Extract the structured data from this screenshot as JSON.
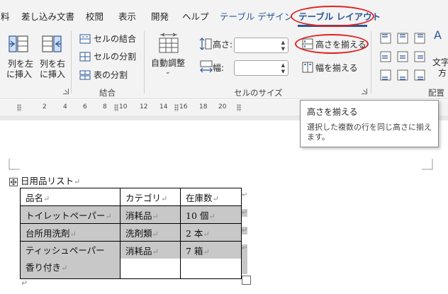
{
  "ribbon": {
    "tabs": [
      {
        "label": "料"
      },
      {
        "label": "差し込み文書"
      },
      {
        "label": "校閲"
      },
      {
        "label": "表示"
      },
      {
        "label": "開発"
      },
      {
        "label": "ヘルプ"
      },
      {
        "label": "テーブル デザイン"
      },
      {
        "label": "テーブル レイアウト"
      }
    ],
    "active_tab": "テーブル レイアウト",
    "groups": {
      "rows_cols": {
        "insert_left": {
          "line1": "列を左",
          "line2": "に挿入"
        },
        "insert_right": {
          "line1": "列を右",
          "line2": "に挿入"
        }
      },
      "merge": {
        "label": "結合",
        "merge_cells": "セルの結合",
        "split_cells": "セルの分割",
        "split_table": "表の分割"
      },
      "cell_size": {
        "label": "セルのサイズ",
        "autofit": "自動調整",
        "height_label": "高さ:",
        "width_label": "幅:",
        "height_value": "",
        "width_value": "",
        "distribute_rows": "高さを揃える",
        "distribute_cols": "幅を揃える"
      },
      "alignment": {
        "label": "配置",
        "text_direction_line1": "文字",
        "text_direction_line2": "方"
      }
    }
  },
  "ruler": {
    "numbers": [
      "2",
      "4",
      "6",
      "8",
      "10",
      "12",
      "14",
      "16",
      "18",
      "20"
    ]
  },
  "tooltip": {
    "title": "高さを揃える",
    "description_line1": "選択した複数の行を同じ高さに揃え",
    "description_line2": "ます。"
  },
  "document": {
    "title": "日用品リスト",
    "paragraph_mark": "↵",
    "table": {
      "headers": [
        "品名",
        "カテゴリ",
        "在庫数"
      ],
      "rows": [
        [
          "トイレットペーパー",
          "消耗品",
          "10 個"
        ],
        [
          "台所用洗剤",
          "洗剤類",
          "2 本"
        ],
        [
          "ティッシュペーパー",
          "消耗品",
          "7 箱"
        ]
      ],
      "row3_extra_line": "香り付き"
    }
  },
  "colors": {
    "accent": "#2b579a",
    "annotation": "#e02020",
    "selection": "#c8c8c8",
    "ribbon_bg": "#f3f3f3"
  },
  "icons": [
    "insert-left-icon",
    "insert-right-icon",
    "merge-cells-icon",
    "split-cells-icon",
    "split-table-icon",
    "autofit-icon",
    "row-height-icon",
    "column-width-icon",
    "distribute-rows-icon",
    "distribute-columns-icon",
    "align-icon",
    "text-direction-icon",
    "table-move-handle-icon",
    "table-resize-handle-icon"
  ]
}
